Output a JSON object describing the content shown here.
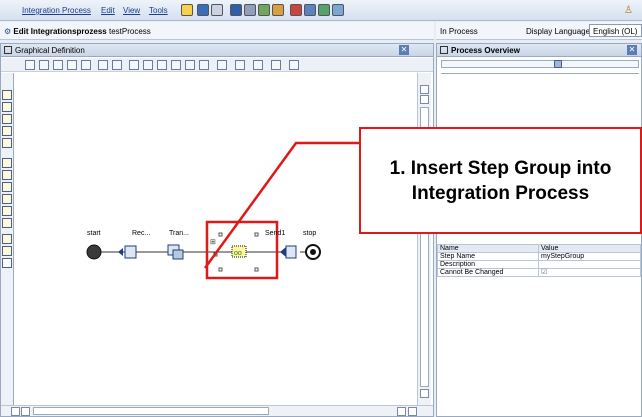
{
  "menubar": {
    "items": [
      "Integration Process",
      "Edit",
      "View",
      "Tools"
    ]
  },
  "editor": {
    "title_prefix": "Edit Integrationsprozess",
    "title_name": "testProcess"
  },
  "right_header": {
    "status": "In Process",
    "language_label": "Display Language",
    "language_value": "English (OL)"
  },
  "left_panel": {
    "title": "Graphical Definition"
  },
  "right_panel": {
    "title": "Process Overview"
  },
  "graph": {
    "nodes": [
      "start",
      "Rec...",
      "Tran...",
      "Send1",
      "stop"
    ]
  },
  "properties": {
    "headers": [
      "Name",
      "Value"
    ],
    "rows": [
      [
        "Step Name",
        "myStepGroup"
      ],
      [
        "Description",
        ""
      ],
      [
        "Cannot Be Changed",
        "☑"
      ]
    ]
  },
  "callout": {
    "text": "1. Insert Step Group into Integration Process"
  },
  "colors": {
    "accent_red": "#e11818",
    "menu_link": "#1a3c8c"
  }
}
